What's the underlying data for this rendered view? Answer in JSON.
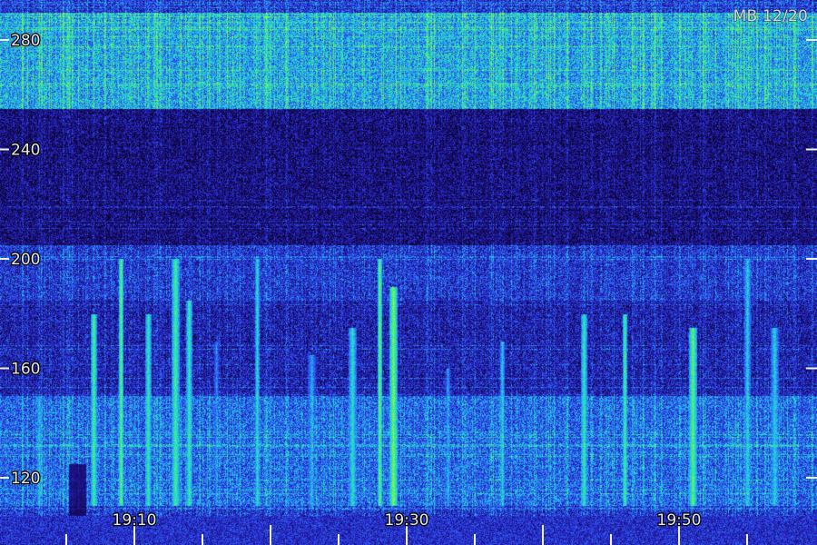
{
  "stamp": "MB 12/20",
  "chart_data": {
    "type": "heatmap",
    "title": "",
    "xlabel": "",
    "ylabel": "",
    "x_tick_labels": [
      "19:10",
      "19:30",
      "19:50"
    ],
    "y_ticks": [
      120,
      160,
      200,
      240,
      280
    ],
    "y_tick_labels": [
      "120",
      "160",
      "200",
      "240",
      "280"
    ],
    "x_ticks_minutes": [
      "19:05",
      "19:10",
      "19:15",
      "19:20",
      "19:25",
      "19:30",
      "19:35",
      "19:40",
      "19:45",
      "19:50",
      "19:55"
    ],
    "ylim": [
      110,
      290
    ],
    "color_scale": [
      "#0a0428",
      "#1a0f7a",
      "#2a2ad8",
      "#2d6cf0",
      "#22c8f0",
      "#30f08a",
      "#b4f030"
    ],
    "bands": [
      {
        "y_from": 255,
        "y_to": 290,
        "level": 0.55
      },
      {
        "y_from": 205,
        "y_to": 255,
        "level": 0.12
      },
      {
        "y_from": 185,
        "y_to": 205,
        "level": 0.3
      },
      {
        "y_from": 150,
        "y_to": 185,
        "level": 0.22
      },
      {
        "y_from": 110,
        "y_to": 150,
        "level": 0.42
      }
    ],
    "bursts": [
      {
        "time": "19:03",
        "y_from": 110,
        "y_to": 150,
        "level": 0.6
      },
      {
        "time": "19:07",
        "y_from": 110,
        "y_to": 180,
        "level": 0.85
      },
      {
        "time": "19:09",
        "y_from": 110,
        "y_to": 200,
        "level": 0.9
      },
      {
        "time": "19:11",
        "y_from": 110,
        "y_to": 180,
        "level": 0.8
      },
      {
        "time": "19:13",
        "y_from": 110,
        "y_to": 200,
        "level": 0.85
      },
      {
        "time": "19:14",
        "y_from": 110,
        "y_to": 185,
        "level": 0.8
      },
      {
        "time": "19:16",
        "y_from": 110,
        "y_to": 170,
        "level": 0.55
      },
      {
        "time": "19:19",
        "y_from": 110,
        "y_to": 200,
        "level": 0.75
      },
      {
        "time": "19:23",
        "y_from": 110,
        "y_to": 165,
        "level": 0.6
      },
      {
        "time": "19:26",
        "y_from": 110,
        "y_to": 175,
        "level": 0.75
      },
      {
        "time": "19:28",
        "y_from": 110,
        "y_to": 200,
        "level": 0.9
      },
      {
        "time": "19:29",
        "y_from": 110,
        "y_to": 190,
        "level": 0.95
      },
      {
        "time": "19:33",
        "y_from": 110,
        "y_to": 160,
        "level": 0.6
      },
      {
        "time": "19:37",
        "y_from": 110,
        "y_to": 170,
        "level": 0.7
      },
      {
        "time": "19:43",
        "y_from": 110,
        "y_to": 180,
        "level": 0.8
      },
      {
        "time": "19:46",
        "y_from": 110,
        "y_to": 180,
        "level": 0.85
      },
      {
        "time": "19:51",
        "y_from": 110,
        "y_to": 175,
        "level": 0.9
      },
      {
        "time": "19:55",
        "y_from": 110,
        "y_to": 200,
        "level": 0.7
      },
      {
        "time": "19:57",
        "y_from": 110,
        "y_to": 175,
        "level": 0.7
      }
    ]
  }
}
